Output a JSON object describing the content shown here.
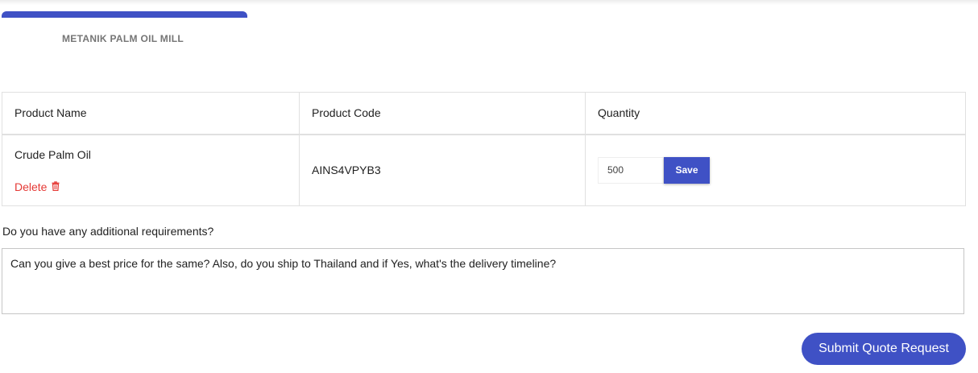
{
  "tab": {
    "label": "METANIK PALM OIL MILL"
  },
  "table": {
    "headers": [
      "Product Name",
      "Product Code",
      "Quantity"
    ],
    "rows": [
      {
        "product_name": "Crude Palm Oil",
        "delete_label": "Delete",
        "product_code": "AINS4VPYB3",
        "quantity": "500",
        "save_label": "Save"
      }
    ]
  },
  "requirements": {
    "label": "Do you have any additional requirements?",
    "value": "Can you give a best price for the same? Also, do you ship to Thailand and if Yes, what's the delivery timeline?"
  },
  "submit_label": "Submit Quote Request",
  "colors": {
    "primary": "#3f51c5",
    "danger": "#e53935"
  },
  "icons": {
    "delete": "trash-icon"
  }
}
